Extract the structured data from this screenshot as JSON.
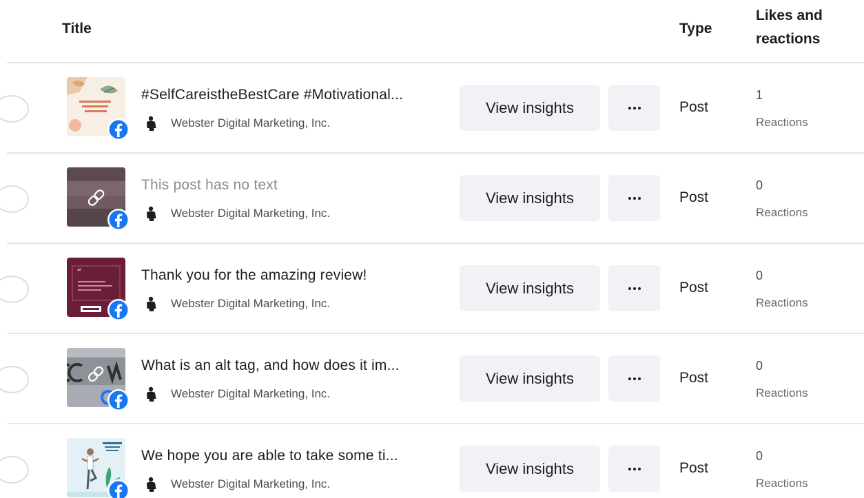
{
  "columns": {
    "title": "Title",
    "type": "Type",
    "likes_line1": "Likes and",
    "likes_line2": "reactions"
  },
  "actions": {
    "view_insights_label": "View insights"
  },
  "colors": {
    "facebook_blue": "#1877f2",
    "button_bg": "#f0f2f5",
    "divider": "#e4e6eb",
    "muted_text": "#8a8d91"
  },
  "rows": [
    {
      "title": "#SelfCareistheBestCare #Motivational...",
      "author": "Webster Digital Marketing, Inc.",
      "type": "Post",
      "count": "1",
      "count_label": "Reactions",
      "thumbnail_icon": "selfcare-graphic",
      "platform_icon": "facebook-icon"
    },
    {
      "title": "This post has no text",
      "author": "Webster Digital Marketing, Inc.",
      "type": "Post",
      "count": "0",
      "count_label": "Reactions",
      "thumbnail_icon": "link-icon",
      "platform_icon": "facebook-icon"
    },
    {
      "title": "Thank you for the amazing review!",
      "author": "Webster Digital Marketing, Inc.",
      "type": "Post",
      "count": "0",
      "count_label": "Reactions",
      "thumbnail_icon": "review-graphic",
      "platform_icon": "facebook-icon"
    },
    {
      "title": "What is an alt tag, and how does it im...",
      "author": "Webster Digital Marketing, Inc.",
      "type": "Post",
      "count": "0",
      "count_label": "Reactions",
      "thumbnail_icon": "link-icon",
      "platform_icon": "facebook-icon"
    },
    {
      "title": "We hope you are able to take some ti...",
      "author": "Webster Digital Marketing, Inc.",
      "type": "Post",
      "count": "0",
      "count_label": "Reactions",
      "thumbnail_icon": "yoga-graphic",
      "platform_icon": "facebook-icon"
    }
  ]
}
